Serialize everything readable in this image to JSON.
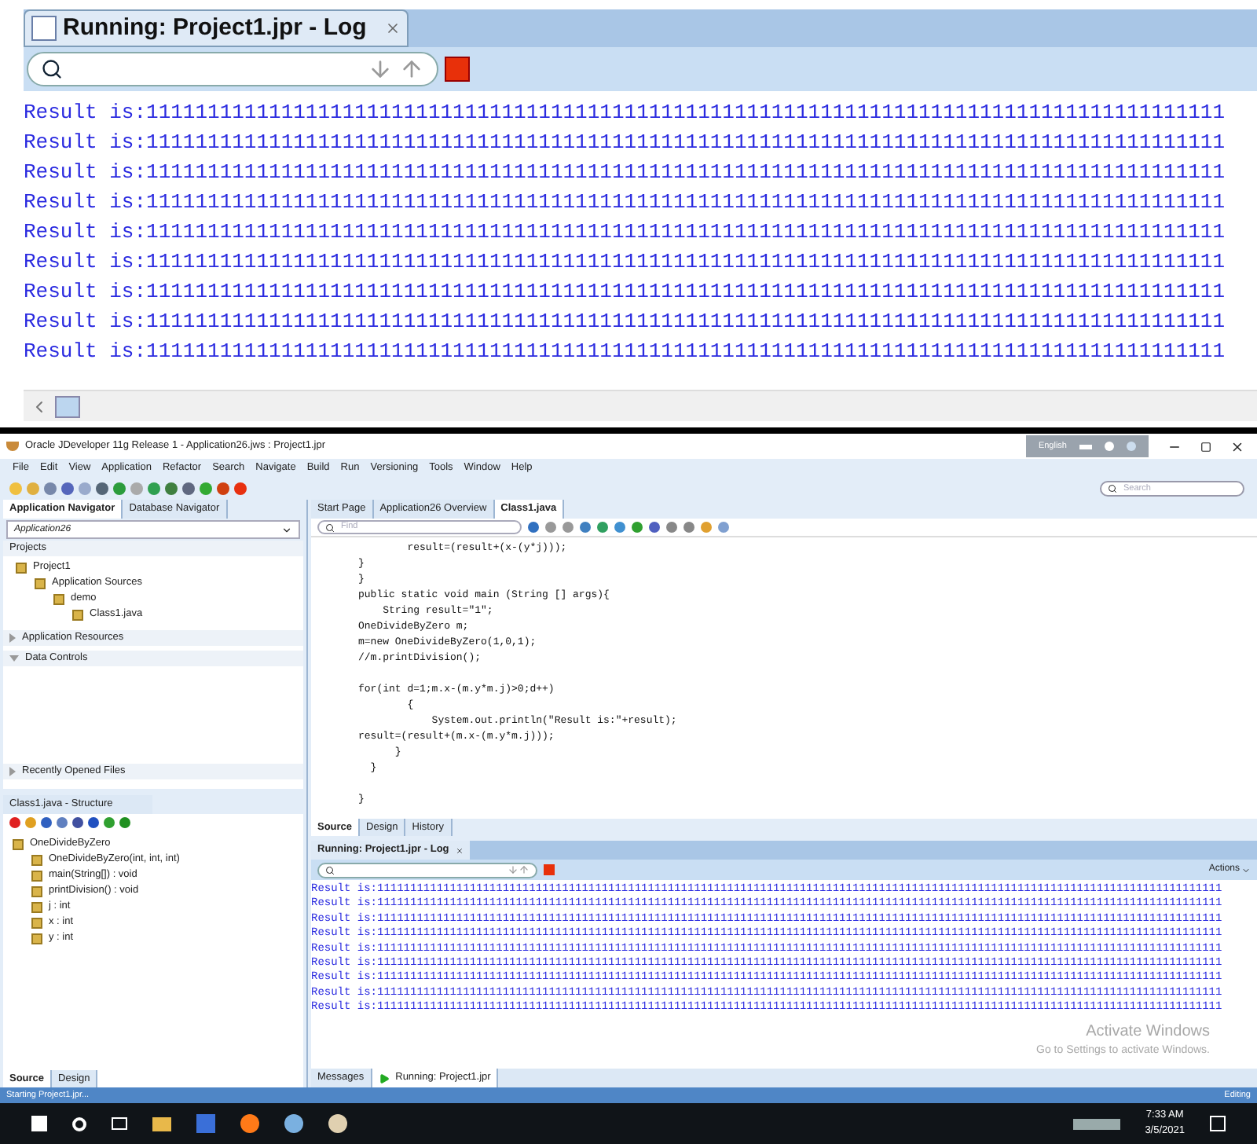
{
  "top_log": {
    "title": "Running: Project1.jpr - Log",
    "lines": [
      "Result is:1111111111111111111111111111111111111111111111111111111111111111111111111111111111111111",
      "Result is:1111111111111111111111111111111111111111111111111111111111111111111111111111111111111111",
      "Result is:1111111111111111111111111111111111111111111111111111111111111111111111111111111111111111",
      "Result is:1111111111111111111111111111111111111111111111111111111111111111111111111111111111111111",
      "Result is:1111111111111111111111111111111111111111111111111111111111111111111111111111111111111111",
      "Result is:1111111111111111111111111111111111111111111111111111111111111111111111111111111111111111",
      "Result is:1111111111111111111111111111111111111111111111111111111111111111111111111111111111111111",
      "Result is:1111111111111111111111111111111111111111111111111111111111111111111111111111111111111111",
      "Result is:1111111111111111111111111111111111111111111111111111111111111111111111111111111111111111"
    ]
  },
  "ide": {
    "title": "Oracle JDeveloper 11g Release 1 - Application26.jws : Project1.jpr",
    "language": "English",
    "menu": [
      "File",
      "Edit",
      "View",
      "Application",
      "Refactor",
      "Search",
      "Navigate",
      "Build",
      "Run",
      "Versioning",
      "Tools",
      "Window",
      "Help"
    ],
    "search_placeholder": "Search",
    "left_tabs": [
      {
        "label": "Application Navigator",
        "selected": true
      },
      {
        "label": "Database Navigator",
        "selected": false
      }
    ],
    "application": "Application26",
    "projects_header": "Projects",
    "project_tree": [
      {
        "label": "Project1",
        "children": [
          {
            "label": "Application Sources",
            "children": [
              {
                "label": "demo",
                "children": [
                  {
                    "label": "Class1.java"
                  }
                ]
              }
            ]
          }
        ]
      }
    ],
    "sections": [
      {
        "label": "Application Resources",
        "expanded": false
      },
      {
        "label": "Data Controls",
        "expanded": true
      }
    ],
    "recent": {
      "label": "Recently Opened Files",
      "expanded": false
    },
    "structure": {
      "title": "Class1.java - Structure",
      "tree": [
        {
          "label": "OneDivideByZero",
          "children": [
            {
              "label": "OneDivideByZero(int, int, int)"
            },
            {
              "label": "main(String[]) : void"
            },
            {
              "label": "printDivision() : void"
            },
            {
              "label": "j : int"
            },
            {
              "label": "x : int"
            },
            {
              "label": "y : int"
            }
          ]
        }
      ]
    },
    "left_bottom_tabs": [
      {
        "label": "Source",
        "selected": true
      },
      {
        "label": "Design",
        "selected": false
      }
    ],
    "editor_tabs": [
      {
        "label": "Start Page",
        "selected": false
      },
      {
        "label": "Application26 Overview",
        "selected": false
      },
      {
        "label": "Class1.java",
        "selected": true
      }
    ],
    "find_placeholder": "Find",
    "code": [
      {
        "kind": "text",
        "text": "        result=(result+(x-(y*j)));"
      },
      {
        "kind": "text",
        "text": "}"
      },
      {
        "kind": "text",
        "text": "}"
      },
      {
        "kind": "text",
        "text": "public static void main (String [] args){"
      },
      {
        "kind": "text",
        "text": "    String result=\"1\";"
      },
      {
        "kind": "text",
        "text": "OneDivideByZero m;"
      },
      {
        "kind": "text",
        "text": "m=new OneDivideByZero(1,0,1);"
      },
      {
        "kind": "text",
        "text": "//m.printDivision();"
      },
      {
        "kind": "blank"
      },
      {
        "kind": "text",
        "text": "for(int d=1;m.x-(m.y*m.j)>0;d++)"
      },
      {
        "kind": "text",
        "text": "        {"
      },
      {
        "kind": "text",
        "text": "            System.out.println(\"Result is:\"+result);"
      },
      {
        "kind": "text",
        "text": "result=(result+(m.x-(m.y*m.j)));"
      },
      {
        "kind": "text",
        "text": "      }"
      },
      {
        "kind": "text",
        "text": "  }"
      },
      {
        "kind": "blank"
      },
      {
        "kind": "text",
        "text": "}"
      }
    ],
    "editor_bottom_tabs": [
      {
        "label": "Source",
        "selected": true
      },
      {
        "label": "Design",
        "selected": false
      },
      {
        "label": "History",
        "selected": false
      }
    ],
    "log": {
      "title": "Running: Project1.jpr - Log",
      "actions": "Actions",
      "lines": [
        "Result is:11111111111111111111111111111111111111111111111111111111111111111111111111111111111111111111111111111111111111111111111111111111",
        "Result is:11111111111111111111111111111111111111111111111111111111111111111111111111111111111111111111111111111111111111111111111111111111",
        "Result is:11111111111111111111111111111111111111111111111111111111111111111111111111111111111111111111111111111111111111111111111111111111",
        "Result is:11111111111111111111111111111111111111111111111111111111111111111111111111111111111111111111111111111111111111111111111111111111",
        "Result is:11111111111111111111111111111111111111111111111111111111111111111111111111111111111111111111111111111111111111111111111111111111",
        "Result is:11111111111111111111111111111111111111111111111111111111111111111111111111111111111111111111111111111111111111111111111111111111",
        "Result is:11111111111111111111111111111111111111111111111111111111111111111111111111111111111111111111111111111111111111111111111111111111",
        "Result is:11111111111111111111111111111111111111111111111111111111111111111111111111111111111111111111111111111111111111111111111111111111",
        "Result is:11111111111111111111111111111111111111111111111111111111111111111111111111111111111111111111111111111111111111111111111111111111"
      ],
      "watermark": [
        "Activate Windows",
        "Go to Settings to activate Windows."
      ]
    },
    "bottom_tabs": [
      {
        "label": "Messages",
        "selected": false
      },
      {
        "label": "Running: Project1.jpr",
        "selected": true
      }
    ],
    "status": {
      "left": "Starting Project1.jpr...",
      "right": "Editing"
    }
  },
  "taskbar": {
    "time": "7:33 AM",
    "date": "3/5/2021"
  }
}
